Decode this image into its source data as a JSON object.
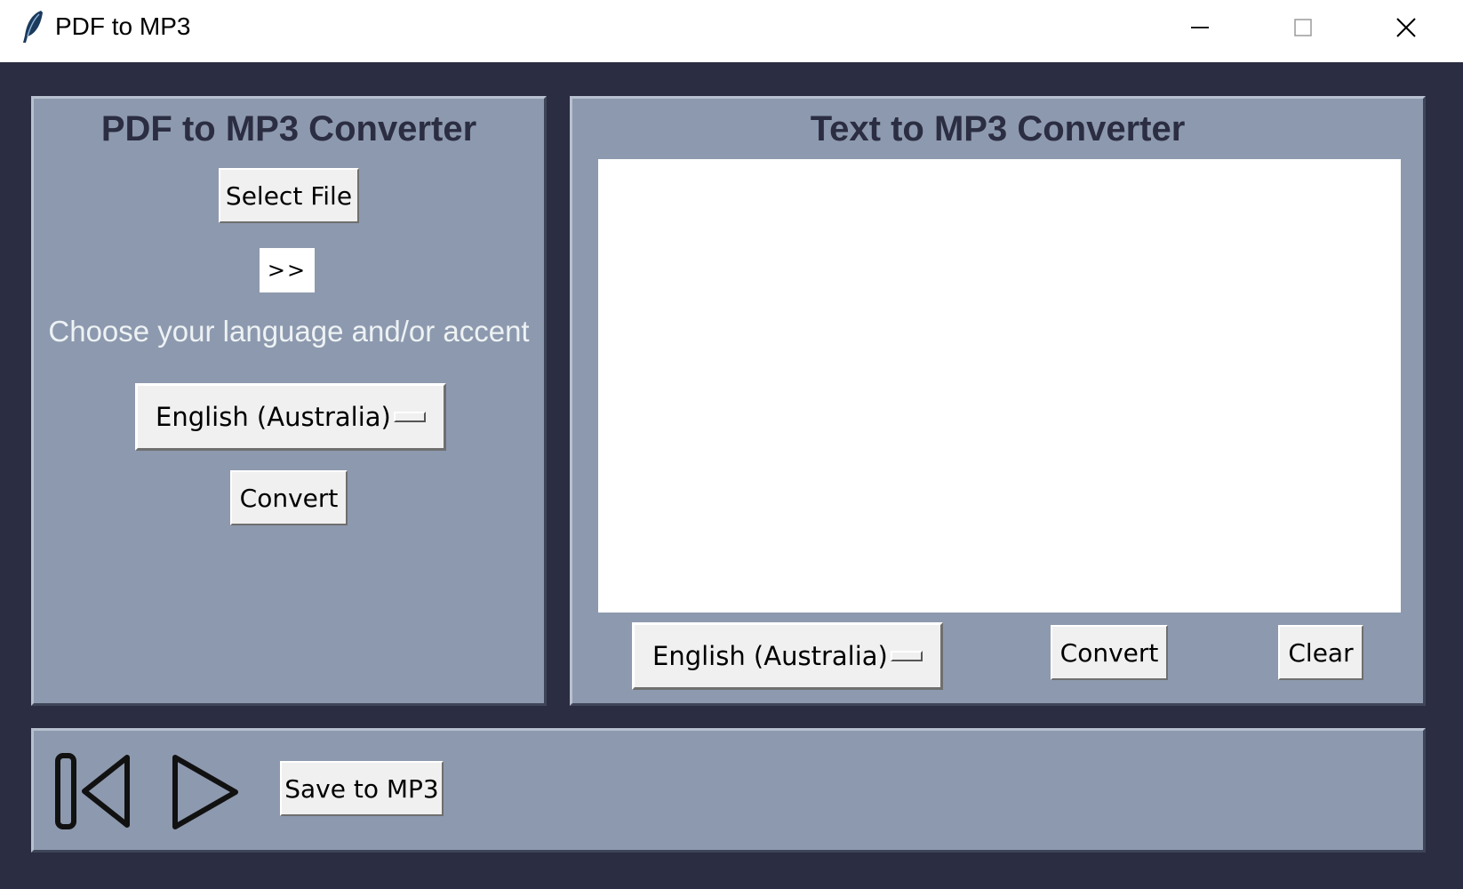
{
  "window": {
    "title": "PDF to MP3",
    "icon": "feather-icon",
    "controls": [
      "minimize-icon",
      "maximize-icon",
      "close-icon"
    ]
  },
  "pdf_panel": {
    "title": "PDF to MP3 Converter",
    "select_file_label": "Select File",
    "file_indicator": ">>",
    "language_prompt": "Choose your language and/or accent",
    "language_selected": "English (Australia)",
    "convert_label": "Convert"
  },
  "text_panel": {
    "title": "Text to MP3 Converter",
    "text_value": "",
    "language_selected": "English (Australia)",
    "convert_label": "Convert",
    "clear_label": "Clear"
  },
  "playback_bar": {
    "icons": [
      "skip-back-icon",
      "play-icon"
    ],
    "save_label": "Save to MP3"
  },
  "colors": {
    "window_bg": "#2b2d42",
    "panel_bg": "#8d99ae",
    "title_text": "#2b2d42",
    "prompt_text": "#edf2f4",
    "button_bg": "#f0f0f0"
  }
}
